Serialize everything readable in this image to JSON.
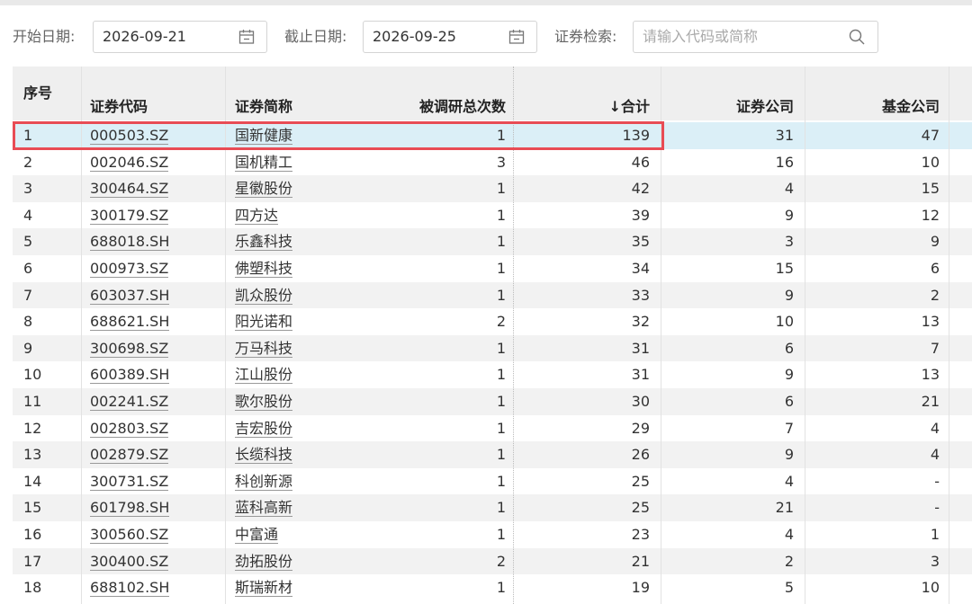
{
  "filters": {
    "start_label": "开始日期:",
    "start_value": "2026-09-21",
    "end_label": "截止日期:",
    "end_value": "2026-09-25",
    "search_label": "证券检索:",
    "search_placeholder": "请输入代码或简称",
    "icons": [
      "calendar-icon",
      "calendar-icon",
      "search-icon"
    ]
  },
  "table": {
    "headers": {
      "seq": "序号",
      "code": "证券代码",
      "name": "证券简称",
      "total_times": "被调研总次数",
      "sum": "↓合计",
      "securities": "证券公司",
      "fund": "基金公司"
    },
    "rows": [
      {
        "seq": "1",
        "code": "000503.SZ",
        "name": "国新健康",
        "times": "1",
        "sum": "139",
        "sec": "31",
        "fund": "47"
      },
      {
        "seq": "2",
        "code": "002046.SZ",
        "name": "国机精工",
        "times": "3",
        "sum": "46",
        "sec": "16",
        "fund": "10"
      },
      {
        "seq": "3",
        "code": "300464.SZ",
        "name": "星徽股份",
        "times": "1",
        "sum": "42",
        "sec": "4",
        "fund": "15"
      },
      {
        "seq": "4",
        "code": "300179.SZ",
        "name": "四方达",
        "times": "1",
        "sum": "39",
        "sec": "9",
        "fund": "12"
      },
      {
        "seq": "5",
        "code": "688018.SH",
        "name": "乐鑫科技",
        "times": "1",
        "sum": "35",
        "sec": "3",
        "fund": "9"
      },
      {
        "seq": "6",
        "code": "000973.SZ",
        "name": "佛塑科技",
        "times": "1",
        "sum": "34",
        "sec": "15",
        "fund": "6"
      },
      {
        "seq": "7",
        "code": "603037.SH",
        "name": "凯众股份",
        "times": "1",
        "sum": "33",
        "sec": "9",
        "fund": "2"
      },
      {
        "seq": "8",
        "code": "688621.SH",
        "name": "阳光诺和",
        "times": "2",
        "sum": "32",
        "sec": "10",
        "fund": "13"
      },
      {
        "seq": "9",
        "code": "300698.SZ",
        "name": "万马科技",
        "times": "1",
        "sum": "31",
        "sec": "6",
        "fund": "7"
      },
      {
        "seq": "10",
        "code": "600389.SH",
        "name": "江山股份",
        "times": "1",
        "sum": "31",
        "sec": "9",
        "fund": "13"
      },
      {
        "seq": "11",
        "code": "002241.SZ",
        "name": "歌尔股份",
        "times": "1",
        "sum": "30",
        "sec": "6",
        "fund": "21"
      },
      {
        "seq": "12",
        "code": "002803.SZ",
        "name": "吉宏股份",
        "times": "1",
        "sum": "29",
        "sec": "7",
        "fund": "4"
      },
      {
        "seq": "13",
        "code": "002879.SZ",
        "name": "长缆科技",
        "times": "1",
        "sum": "26",
        "sec": "9",
        "fund": "4"
      },
      {
        "seq": "14",
        "code": "300731.SZ",
        "name": "科创新源",
        "times": "1",
        "sum": "25",
        "sec": "4",
        "fund": "-"
      },
      {
        "seq": "15",
        "code": "601798.SH",
        "name": "蓝科高新",
        "times": "1",
        "sum": "25",
        "sec": "21",
        "fund": "-"
      },
      {
        "seq": "16",
        "code": "300560.SZ",
        "name": "中富通",
        "times": "1",
        "sum": "23",
        "sec": "4",
        "fund": "1"
      },
      {
        "seq": "17",
        "code": "300400.SZ",
        "name": "劲拓股份",
        "times": "2",
        "sum": "21",
        "sec": "2",
        "fund": "3"
      },
      {
        "seq": "18",
        "code": "688102.SH",
        "name": "斯瑞新材",
        "times": "1",
        "sum": "19",
        "sec": "5",
        "fund": "10"
      }
    ]
  },
  "colors": {
    "highlight_border": "#e84c55",
    "selected_row": "#dbeff7",
    "header_bg": "#efefef",
    "stripe_bg": "#f2f2f2"
  }
}
